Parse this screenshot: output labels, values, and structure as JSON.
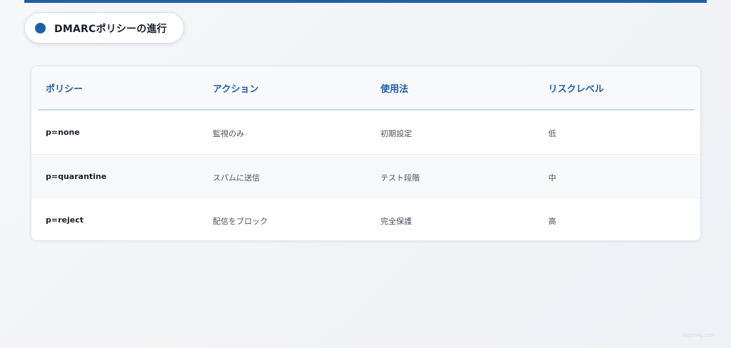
{
  "title": "DMARCポリシーの進行",
  "table": {
    "headers": [
      "ポリシー",
      "アクション",
      "使用法",
      "リスクレベル"
    ],
    "rows": [
      [
        "p=none",
        "監視のみ",
        "初期設定",
        "低"
      ],
      [
        "p=quarantine",
        "スパムに送信",
        "テスト段階",
        "中"
      ],
      [
        "p=reject",
        "配信をブロック",
        "完全保護",
        "高"
      ]
    ]
  },
  "watermark": "skysnag.com",
  "colors": {
    "accent": "#1f5fa6",
    "text": "#1a1f2b"
  }
}
